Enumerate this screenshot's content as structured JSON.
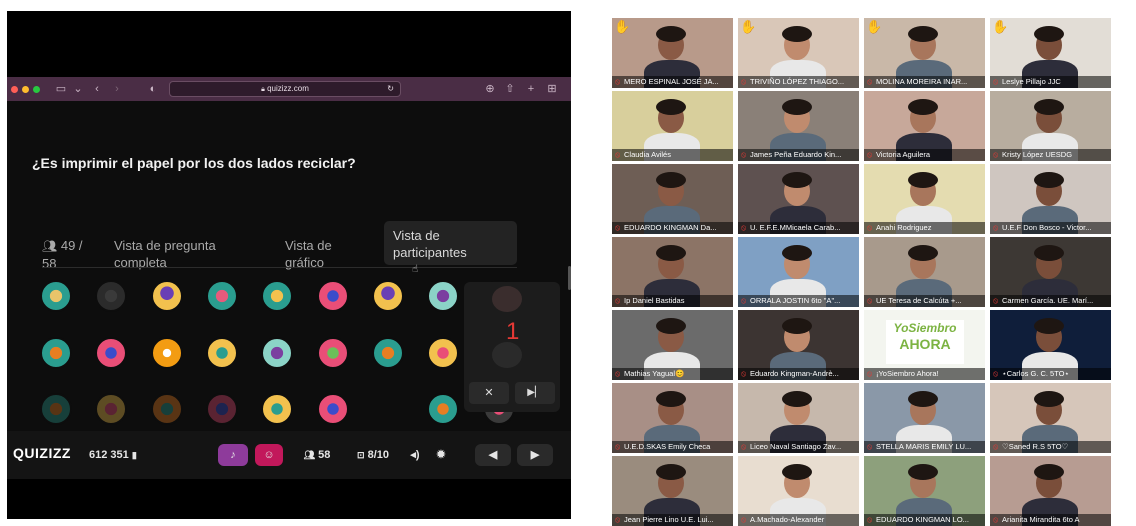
{
  "browser": {
    "url": "quizizz.com"
  },
  "quiz": {
    "question": "¿Es imprimir el papel por los dos lados reciclar?",
    "participants_count_line1": "49 /",
    "participants_count_line2": "58",
    "tabs": [
      {
        "line1": "Vista de pregunta",
        "line2": "completa"
      },
      {
        "line1": "Vista de",
        "line2": "gráfico"
      },
      {
        "line1": "Vista de",
        "line2": "participantes"
      }
    ],
    "floating_number": "1"
  },
  "bottombar": {
    "brand": "QUIZIZZ",
    "game_code": "612 351",
    "players": "58",
    "progress": "8/10"
  },
  "participants": [
    {
      "name": "MERO ESPINAL JOSÉ JA...",
      "hand": true
    },
    {
      "name": "TRIVIÑO LÓPEZ THIAGO...",
      "hand": true
    },
    {
      "name": "MOLINA MOREIRA INAR...",
      "hand": true
    },
    {
      "name": "Leslye  Pillajo JJC",
      "hand": true
    },
    {
      "name": "Claudia Avilés",
      "hand": false
    },
    {
      "name": "James Peña Eduardo Kin...",
      "hand": false
    },
    {
      "name": "Victoria Aguilera",
      "hand": false
    },
    {
      "name": "Kristy López UESDG",
      "hand": false
    },
    {
      "name": "EDUARDO KINGMAN Da...",
      "hand": false
    },
    {
      "name": "U. E.F.E.MMicaela Carab...",
      "hand": false
    },
    {
      "name": "Anahi Rodriguez",
      "hand": false
    },
    {
      "name": "U.E.F Don Bosco - Victor...",
      "hand": false
    },
    {
      "name": "Ip Daniel Bastidas",
      "hand": false
    },
    {
      "name": "ORRALA JOSTIN 6to \"A\"...",
      "hand": false
    },
    {
      "name": "UE Teresa de Calcúta +...",
      "hand": false
    },
    {
      "name": "Carmen García. UE. Marí...",
      "hand": false
    },
    {
      "name": "Mathias Yagual😊",
      "hand": false
    },
    {
      "name": "Eduardo Kingman-Andrè...",
      "hand": false
    },
    {
      "name": "¡YoSiembro Ahora!",
      "hand": false
    },
    {
      "name": "⋆Carlos G. C. 5TO⋆",
      "hand": false
    },
    {
      "name": "U.E.D.SKAS Emily Checa",
      "hand": false
    },
    {
      "name": "Liceo Naval Santiago Zav...",
      "hand": false
    },
    {
      "name": "STELLA MARIS EMILY LU...",
      "hand": false
    },
    {
      "name": "♡Saned R.S 5TO♡",
      "hand": false
    },
    {
      "name": "Jean Pierre Lino U.E. Lui...",
      "hand": false
    },
    {
      "name": "A.Machado-Alexander",
      "hand": false
    },
    {
      "name": "EDUARDO KINGMAN LO...",
      "hand": false
    },
    {
      "name": "Arianita Mirandita 6to A",
      "hand": false
    }
  ],
  "yosiembro_logo": {
    "line1": "YoSiembro",
    "line2": "AHORA"
  },
  "colors": {
    "browser_bar": "#4a2d45",
    "quiz_bg": "#0d0d0d",
    "mic_muted": "#e53935",
    "accent_purple": "#8e3b9b",
    "accent_pink": "#c2185b"
  }
}
